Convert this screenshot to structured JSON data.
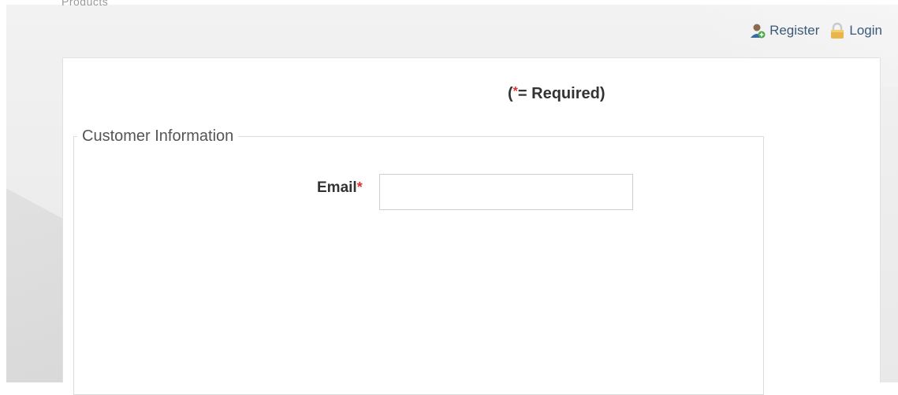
{
  "header": {
    "brand_fragment": "Products",
    "links": {
      "register": "Register",
      "login": "Login"
    }
  },
  "form": {
    "required_note": {
      "open": "(",
      "star": "*",
      "text": "= Required)"
    },
    "section_legend": "Customer Information",
    "email": {
      "label": "Email",
      "star": "*",
      "value": "",
      "placeholder": ""
    }
  },
  "colors": {
    "required_star": "#e03030",
    "link": "#3a5a7a",
    "login_icon": "#e8b64a"
  },
  "icons": {
    "register": "user-add-icon",
    "login": "lock-icon"
  }
}
